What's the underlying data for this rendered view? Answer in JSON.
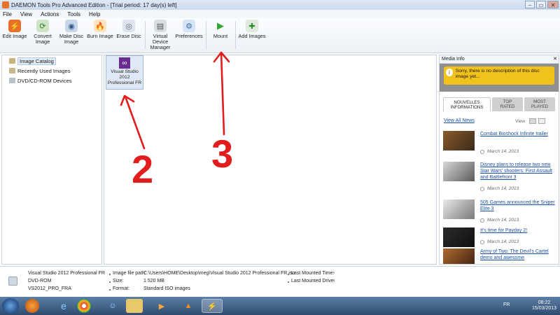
{
  "window": {
    "title": "DAEMON Tools Pro Advanced Edition - [Trial period: 17 day(s) left]",
    "controls": {
      "minimize": "–",
      "maximize": "▭",
      "close": "✕"
    }
  },
  "menu": {
    "items": [
      "File",
      "View",
      "Actions",
      "Tools",
      "Help"
    ]
  },
  "toolbar": {
    "buttons": [
      {
        "label": "Edit Image",
        "icon": "edit-image-icon"
      },
      {
        "label": "Convert\nImage",
        "icon": "convert-image-icon"
      },
      {
        "label": "Make Disc\nImage",
        "icon": "make-disc-image-icon"
      },
      {
        "label": "Burn Image",
        "icon": "burn-image-icon"
      },
      {
        "label": "Erase Disc",
        "icon": "erase-disc-icon"
      },
      {
        "label": "Virtual\nDevice\nManager",
        "icon": "virtual-device-icon"
      },
      {
        "label": "Preferences",
        "icon": "gear-icon"
      },
      {
        "label": "Mount",
        "icon": "play-icon"
      },
      {
        "label": "Add Images",
        "icon": "add-images-icon"
      }
    ]
  },
  "sidebar": {
    "items": [
      {
        "label": "Image Catalog",
        "selected": true
      },
      {
        "label": "Recently Used Images",
        "selected": false
      },
      {
        "label": "DVD/CD-ROM Devices",
        "selected": false
      }
    ]
  },
  "catalog": {
    "tile_label": "Visual Studio\n2012\nProfessional FR"
  },
  "annotations": {
    "step_a": "2",
    "step_b": "3",
    "color": "#e11d1d"
  },
  "media_info": {
    "title": "Media Info",
    "close": "✕",
    "description": "Sorry, there is no description of this disc image yet...",
    "tabs": [
      "NOUVELLES\nINFORMATIONS",
      "TOP\nRATED",
      "MOST\nPLAYED"
    ],
    "view_all": "View All News",
    "view_label": "View",
    "news": [
      {
        "title": "Combat Bioshock Infinite trailer",
        "date": "March 14, 2013"
      },
      {
        "title": "Disney plans to release two new Star Wars' shooters: First Assault and Battlefront 3",
        "date": "March 14, 2013"
      },
      {
        "title": "505 Games announced the Sniper Elite 3",
        "date": "March 14, 2013"
      },
      {
        "title": "It's time for Payday 2!",
        "date": "March 14, 2013"
      },
      {
        "title": "Army of Two: The Devil's Cartel demo and awesome",
        "date": "March 14, 2013"
      }
    ]
  },
  "status": {
    "name": "Visual Studio 2012 Professional FR",
    "type": "DVD-ROM",
    "label": "VS2012_PRO_FRA",
    "path_label": "Image file path:",
    "path_value": "C:\\Users\\HOME\\Desktop\\meg\\Visual Studio 2012 Professional FR.iso",
    "size_label": "Size:",
    "size_value": "1 520 MB",
    "format_label": "Format:",
    "format_value": "Standard ISO images",
    "last_time_label": "Last Mounted Time:",
    "last_time_value": "-",
    "last_drive_label": "Last Mounted Drive:",
    "last_drive_value": "-"
  },
  "taskbar": {
    "lang": "FR",
    "time": "08:22",
    "date": "15/03/2013"
  }
}
